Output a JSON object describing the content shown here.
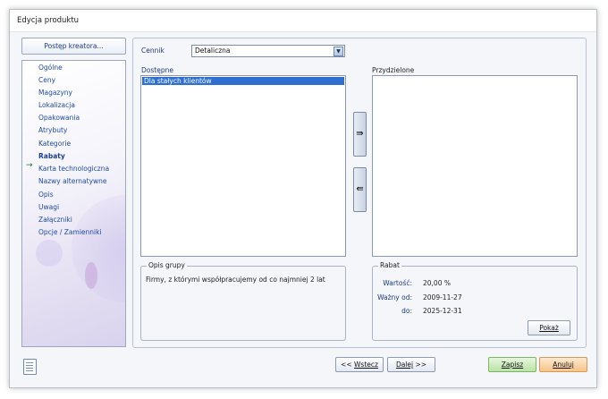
{
  "window": {
    "title": "Edycja produktu"
  },
  "sidebar": {
    "progress_button": "Postęp kreatora...",
    "items": [
      {
        "label": "Ogólne"
      },
      {
        "label": "Ceny"
      },
      {
        "label": "Magazyny"
      },
      {
        "label": "Lokalizacja"
      },
      {
        "label": "Opakowania"
      },
      {
        "label": "Atrybuty"
      },
      {
        "label": "Kategorie"
      },
      {
        "label": "Rabaty",
        "active": true
      },
      {
        "label": "Karta technologiczna"
      },
      {
        "label": "Nazwy alternatywne"
      },
      {
        "label": "Opis"
      },
      {
        "label": "Uwagi"
      },
      {
        "label": "Załączniki"
      },
      {
        "label": "Opcje / Zamienniki"
      }
    ],
    "active_marker": "→"
  },
  "main": {
    "cennik_label": "Cennik",
    "cennik_value": "Detaliczna",
    "available_label": "Dostępne",
    "available_items": [
      "Dla stałych klientów"
    ],
    "assigned_label": "Przydzielone",
    "assigned_items": [],
    "move_right_glyph": "⇛",
    "move_left_glyph": "⇚",
    "group_desc": {
      "legend": "Opis grupy",
      "text": "Firmy, z którymi współpracujemy od co najmniej 2 lat"
    },
    "rabat": {
      "legend": "Rabat",
      "wartosc_label": "Wartość:",
      "wartosc_value": "20,00 %",
      "wazny_od_label": "Ważny od:",
      "wazny_od_value": "2009-11-27",
      "do_label": "do:",
      "do_value": "2025-12-31",
      "pokaz_label": "Pokaż"
    }
  },
  "footer": {
    "back_prefix": "<< ",
    "back_label": "Wstecz",
    "next_label": "Dalej",
    "next_suffix": " >>",
    "save_label": "Zapisz",
    "cancel_label": "Anuluj"
  }
}
